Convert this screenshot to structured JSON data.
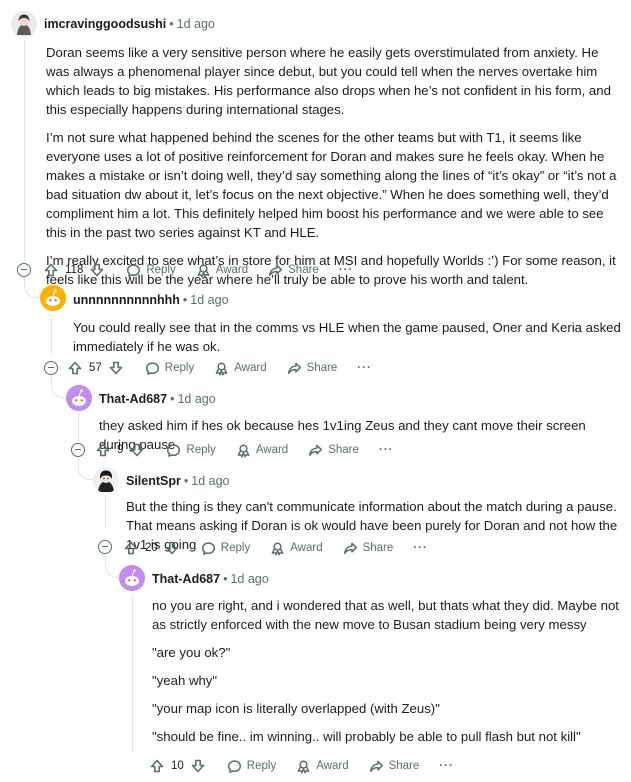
{
  "thread": [
    {
      "author": "imcravinggoodsushi",
      "age": "1d ago",
      "paragraphs": [
        "Doran seems like a very sensitive person where he easily gets overstimulated from anxiety. He was always a phenomenal player since debut, but you could tell when the nerves overtake him which leads to big mistakes. His performance also drops when he’s not confident in his form, and this especially happens during international stages.",
        "I’m not sure what happened behind the scenes for the other teams but with T1, it seems like everyone uses a lot of positive reinforcement for Doran and makes sure he feels okay. When he makes a mistake or isn’t doing well, they’d say something along the lines of “it’s okay” or “it’s not a bad situation dw about it, let’s focus on the next objective.” When he does something well, they’d compliment him a lot. This definitely helped him boost his performance and we were able to see this in the past two series against KT and HLE.",
        "I’m really excited to see what’s in store for him at MSI and hopefully Worlds :’) For some reason, it feels like this will be the year where he’ll truly be able to prove his worth and talent."
      ],
      "votes": "118"
    },
    {
      "author": "unnnnnnnnnnhhh",
      "age": "1d ago",
      "paragraphs": [
        "You could really see that in the comms vs HLE when the game paused, Oner and Keria asked immediately if he was ok."
      ],
      "votes": "57"
    },
    {
      "author": "That-Ad687",
      "age": "1d ago",
      "paragraphs": [
        "they asked him if hes ok because hes 1v1ing Zeus and they cant move their screen during pause"
      ],
      "votes": "9"
    },
    {
      "author": "SilentSpr",
      "age": "1d ago",
      "paragraphs": [
        "But the thing is they can't communicate information about the match during a pause. That means asking if Doran is ok would have been purely for Doran and not how the 1v1 is going"
      ],
      "votes": "20"
    },
    {
      "author": "That-Ad687",
      "age": "1d ago",
      "paragraphs": [
        "no you are right, and i wondered that as well, but thats what they did. Maybe not as strictly enforced with the new move to Busan stadium being very messy",
        "\"are you ok?\"",
        "\"yeah why\"",
        "\"your map icon is literally overlapped (with Zeus)\"",
        "\"should be fine.. im winning.. will probably be able to pull flash but not kill\""
      ],
      "votes": "10"
    }
  ],
  "actions": {
    "reply": "Reply",
    "award": "Award",
    "share": "Share",
    "more": "···"
  },
  "meta_separator": "•",
  "colors": {
    "text": "#1c1c1c",
    "meta": "#576f76",
    "thread_line": "#e1e5e7",
    "avatar_orange": "#ffb000",
    "avatar_purple": "#c18cf0"
  }
}
